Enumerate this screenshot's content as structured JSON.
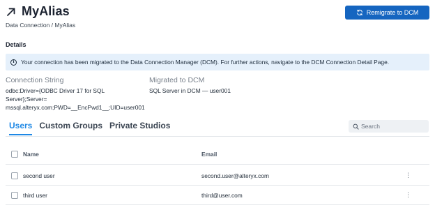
{
  "header": {
    "title": "MyAlias",
    "breadcrumb": "Data Connection / MyAlias",
    "primary_button": "Remigrate to DCM",
    "primary_color": "#1565c0"
  },
  "details": {
    "section_label": "Details",
    "banner": "Your connection has been migrated to the Data Connection Manager (DCM). For further actions, navigate to the DCM Connection Detail Page.",
    "connection_string_label": "Connection String",
    "connection_string_line1": "odbc:Driver={ODBC Driver 17 for SQL Server};Server=",
    "connection_string_line2": "mssql.alteryx.com;PWD=__EncPwd1__;UID=user001",
    "migrated_label": "Migrated to DCM",
    "migrated_value": "SQL Server in DCM — user001"
  },
  "tabs": [
    {
      "label": "Users",
      "active": true
    },
    {
      "label": "Custom Groups",
      "active": false
    },
    {
      "label": "Private Studios",
      "active": false
    }
  ],
  "search": {
    "placeholder": "Search",
    "value": ""
  },
  "table": {
    "columns": [
      "Name",
      "Email"
    ],
    "rows": [
      {
        "name": "second user",
        "email": "second.user@alteryx.com"
      },
      {
        "name": "third user",
        "email": "third@user.com"
      }
    ]
  },
  "icons": {
    "title": "arrow-up-right-icon",
    "button": "refresh-icon",
    "banner": "info-icon",
    "search": "search-icon",
    "row_menu": "kebab-menu-icon"
  },
  "accent_color": "#1e88e5"
}
